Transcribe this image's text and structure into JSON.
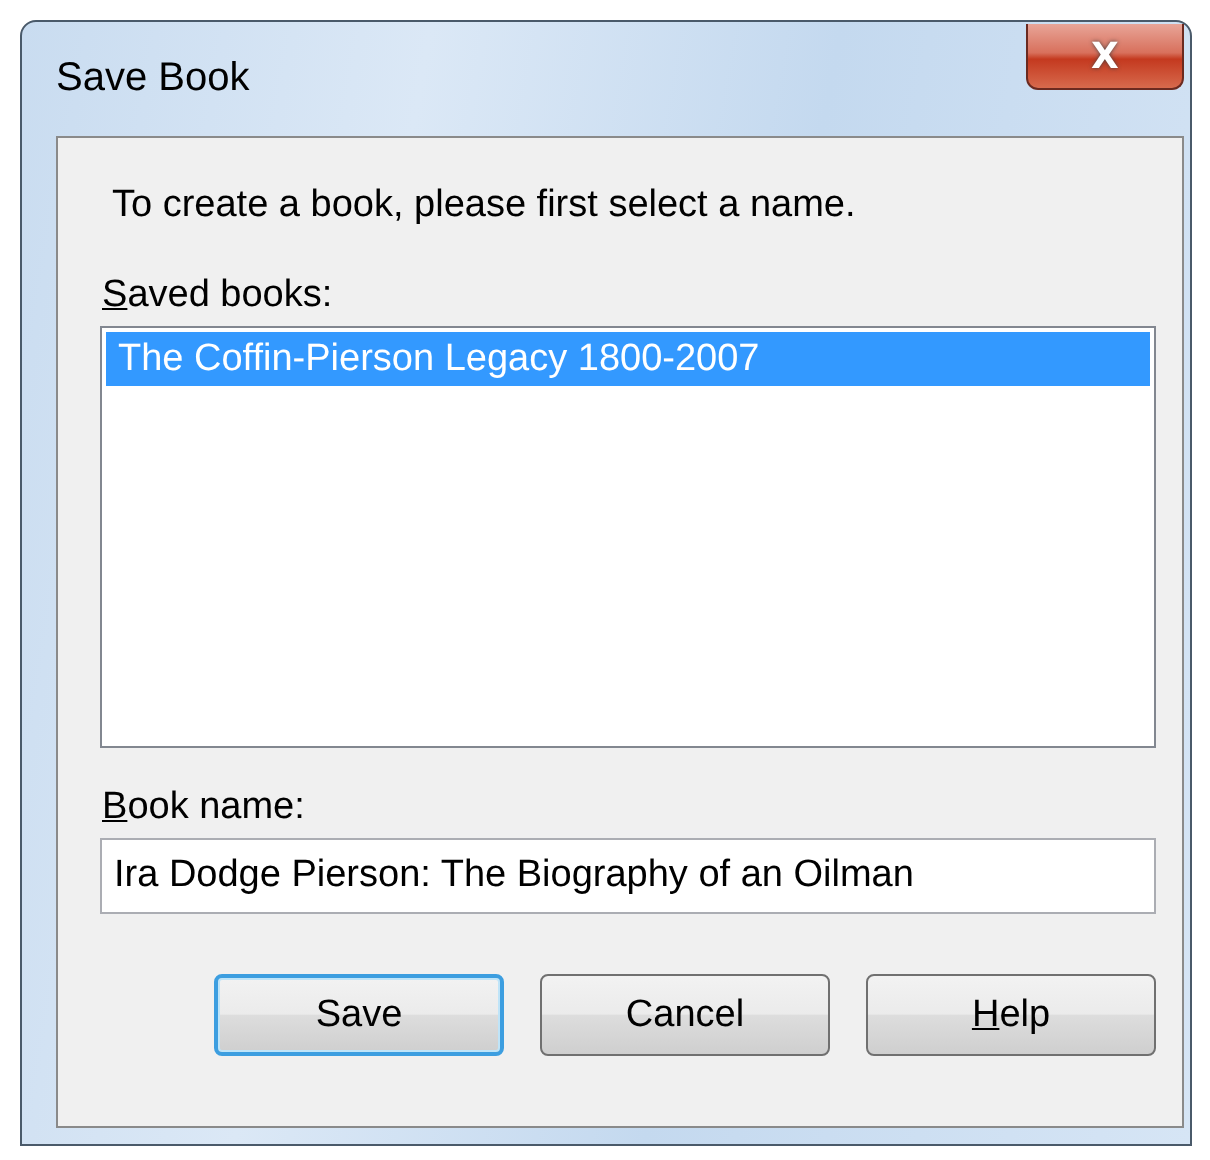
{
  "window": {
    "title": "Save Book",
    "close_label": "X"
  },
  "instruction": "To create a book, please first select a name.",
  "saved_books": {
    "label": "Saved books:",
    "first_letter_underlined": true,
    "items": [
      {
        "name": "The Coffin-Pierson Legacy 1800-2007",
        "selected": true
      }
    ]
  },
  "book_name": {
    "label": "Book name:",
    "first_letter_underlined": true,
    "value": "Ira Dodge Pierson: The Biography of an Oilman"
  },
  "buttons": [
    {
      "label": "Save",
      "default": true,
      "first_letter_underlined": false
    },
    {
      "label": "Cancel",
      "default": false,
      "first_letter_underlined": false
    },
    {
      "label": "Help",
      "default": false,
      "first_letter_underlined": true
    }
  ]
}
